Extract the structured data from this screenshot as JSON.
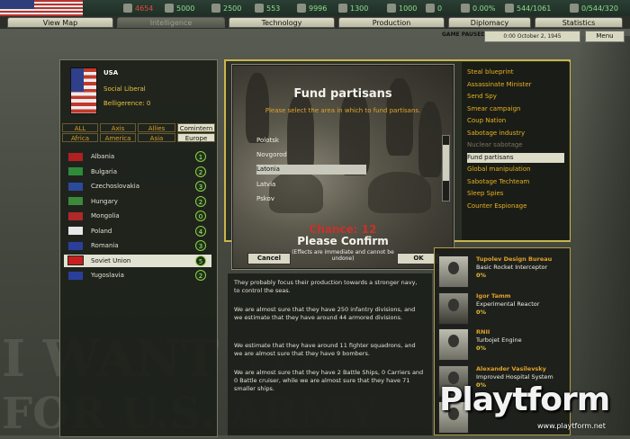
{
  "resources": [
    {
      "name": "energy",
      "value": "4654",
      "color": "red",
      "icon": "energy-icon"
    },
    {
      "name": "metal",
      "value": "5000",
      "color": "green",
      "icon": "metal-icon"
    },
    {
      "name": "rare_materials",
      "value": "2500",
      "color": "green",
      "icon": "rare-materials-icon"
    },
    {
      "name": "oil",
      "value": "553",
      "color": "green",
      "icon": "oil-icon"
    },
    {
      "name": "supplies",
      "value": "9996",
      "color": "green",
      "icon": "supplies-icon"
    },
    {
      "name": "money",
      "value": "1300",
      "color": "green",
      "icon": "money-icon"
    },
    {
      "name": "transports",
      "value": "1000",
      "color": "green",
      "icon": "transport-icon"
    },
    {
      "name": "escorts",
      "value": "0",
      "color": "green",
      "icon": "escort-icon"
    },
    {
      "name": "dissent",
      "value": "0.00%",
      "color": "green",
      "icon": "dissent-icon"
    },
    {
      "name": "manpower",
      "value": "544/1061",
      "color": "green",
      "icon": "manpower-icon"
    },
    {
      "name": "ic",
      "value": "0/544/320",
      "color": "green",
      "icon": "ic-icon"
    }
  ],
  "tabs": [
    "View Map",
    "Intelligence",
    "Technology",
    "Production",
    "Diplomacy",
    "Statistics"
  ],
  "active_tab": "Intelligence",
  "game_status": "GAME PAUSED",
  "date": "0:00 October 2, 1945",
  "menu_label": "Menu",
  "country": {
    "name": "USA",
    "government": "Social Liberal",
    "belligerence": "Belligerence: 0"
  },
  "filters_row1": [
    "ALL",
    "Axis",
    "Allies",
    "Comintern"
  ],
  "filters_row2": [
    "Africa",
    "America",
    "Asia",
    "Europe"
  ],
  "selected_filters": [
    "Comintern",
    "Europe"
  ],
  "countries": [
    {
      "name": "Albania",
      "spies": "1",
      "flag": "#b02020"
    },
    {
      "name": "Bulgaria",
      "spies": "2",
      "flag": "#2e8b3a"
    },
    {
      "name": "Czechoslovakia",
      "spies": "3",
      "flag": "#2a4a9a"
    },
    {
      "name": "Hungary",
      "spies": "2",
      "flag": "#3a8a3a"
    },
    {
      "name": "Mongolia",
      "spies": "0",
      "flag": "#b02828"
    },
    {
      "name": "Poland",
      "spies": "4",
      "flag": "#e8e8e8"
    },
    {
      "name": "Romania",
      "spies": "3",
      "flag": "#2a3f9a"
    },
    {
      "name": "Soviet Union",
      "spies": "5",
      "flag": "#c82020",
      "selected": true
    },
    {
      "name": "Yugoslavia",
      "spies": "2",
      "flag": "#2a3f9a"
    }
  ],
  "missions": [
    {
      "label": "Steal blueprint"
    },
    {
      "label": "Assassinate Minister"
    },
    {
      "label": "Send Spy"
    },
    {
      "label": "Smear campaign"
    },
    {
      "label": "Coup Nation"
    },
    {
      "label": "Sabotage industry"
    },
    {
      "label": "Nuclear sabotage",
      "disabled": true
    },
    {
      "label": "Fund partisans",
      "selected": true
    },
    {
      "label": "Global manipulation"
    },
    {
      "label": "Sabotage Techteam"
    },
    {
      "label": "Sleep Spies"
    },
    {
      "label": "Counter Espionage"
    }
  ],
  "dialog": {
    "title": "Fund partisans",
    "subtitle": "Please select the area in which to fund partisans.",
    "provinces": [
      "Polotsk",
      "Novgorod",
      "Latonia",
      "Latvia",
      "Pskov"
    ],
    "selected_province": "Latonia",
    "chance": "Chance: 12",
    "confirm": "Please Confirm",
    "effects": "(Effects are immediate and cannot be undone)",
    "cancel_label": "Cancel",
    "ok_label": "OK"
  },
  "report": [
    "They probably focus their production towards a stronger navy, to control the seas.",
    "We are almost sure that they have 250 infantry divisions, and we estimate that they have around 44 armored divisions.",
    "We estimate that they have around 11 fighter squadrons, and we are almost sure that they have 9 bombers.",
    "We are almost sure that they have 2 Battle Ships, 0 Carriers and 0 Battle cruiser, while we are almost sure that they have 71 smaller ships."
  ],
  "techs": [
    {
      "team": "Tupolev Design Bureau",
      "project": "Basic Rocket Interceptor",
      "progress": "0%"
    },
    {
      "team": "Igor Tamm",
      "project": "Experimental Reactor",
      "progress": "0%"
    },
    {
      "team": "RNII",
      "project": "Turbojet Engine",
      "progress": "0%"
    },
    {
      "team": "Alexander Vasilevsky",
      "project": "Improved Hospital System",
      "progress": "0%"
    },
    {
      "team": "",
      "project": "",
      "progress": ""
    }
  ],
  "watermark": {
    "logo": "Playtform",
    "url": "www.playtform.net"
  },
  "background_text": [
    "I WANT YO",
    "FOR U.S. ARMY"
  ]
}
